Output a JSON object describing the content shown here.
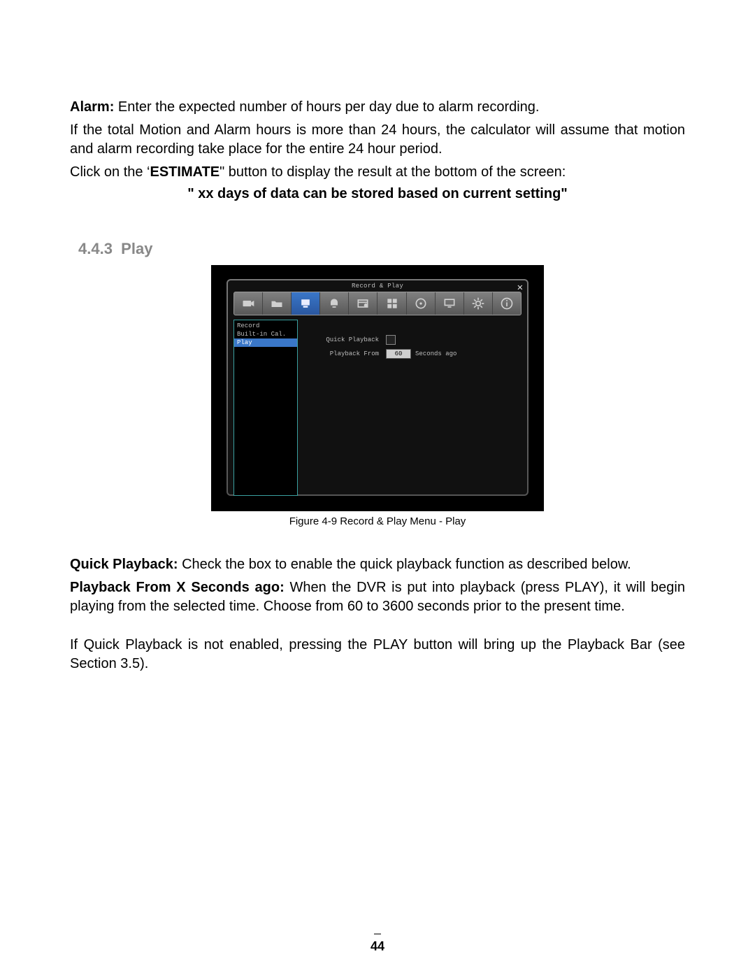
{
  "paragraphs": {
    "alarm_label": "Alarm:",
    "alarm_rest": " Enter the expected number of hours per day due to alarm recording.",
    "total": "If the total Motion and Alarm hours is more than 24 hours, the calculator will assume that motion and alarm recording take place for the entire 24 hour period.",
    "click_pre": "Click on the ‘",
    "estimate": "ESTIMATE",
    "click_post": "\" button to display the result at the bottom of the screen:",
    "result": "\" xx days of data can be stored based on current setting\"",
    "quick_label": "Quick Playback:",
    "quick_rest": " Check the box to enable the quick playback function as described below.",
    "from_label": "Playback From X Seconds ago:",
    "from_rest": " When the DVR is put into playback (press PLAY), it will begin playing from the selected time. Choose from 60 to 3600 seconds prior to the present time.",
    "notenabled": "If Quick Playback is not enabled, pressing the PLAY button will bring up the Playback Bar (see Section 3.5)."
  },
  "section": {
    "number": "4.4.3",
    "title": "Play"
  },
  "figure": {
    "window_title": "Record & Play",
    "sidebar": {
      "items": [
        "Record",
        "Built-in Cal.",
        "Play"
      ],
      "selected_index": 2
    },
    "fields": {
      "quick_label": "Quick Playback",
      "from_label": "Playback From",
      "from_value": "60",
      "from_suffix": "Seconds ago"
    },
    "caption": "Figure 4-9 Record & Play Menu - Play"
  },
  "page_number": "44"
}
